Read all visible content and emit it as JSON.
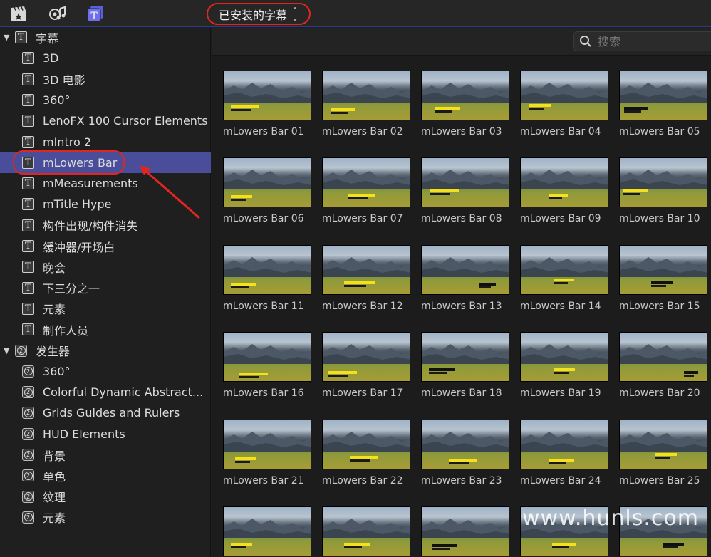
{
  "toolbar": {
    "dropdown_label": "已安装的字幕",
    "dropdown_chevron": "⌃⌄",
    "icons": [
      "clapper-star-icon",
      "music-camera-icon",
      "titles-icon"
    ]
  },
  "sidebar": {
    "groups": [
      {
        "label": "字幕",
        "icon": "titles-icon",
        "items": [
          {
            "label": "3D"
          },
          {
            "label": "3D 电影"
          },
          {
            "label": "360°"
          },
          {
            "label": "LenoFX 100 Cursor Elements"
          },
          {
            "label": "mIntro 2"
          },
          {
            "label": "mLowers Bar",
            "selected": true
          },
          {
            "label": "mMeasurements"
          },
          {
            "label": "mTitle Hype"
          },
          {
            "label": "构件出现/构件消失"
          },
          {
            "label": "缓冲器/开场白"
          },
          {
            "label": "晚会"
          },
          {
            "label": "下三分之一"
          },
          {
            "label": "元素"
          },
          {
            "label": "制作人员"
          }
        ]
      },
      {
        "label": "发生器",
        "icon": "generator-icon",
        "items": [
          {
            "label": "360°"
          },
          {
            "label": "Colorful Dynamic Abstract..."
          },
          {
            "label": "Grids Guides and Rulers"
          },
          {
            "label": "HUD Elements"
          },
          {
            "label": "背景"
          },
          {
            "label": "单色"
          },
          {
            "label": "纹理"
          },
          {
            "label": "元素"
          }
        ]
      }
    ]
  },
  "search": {
    "placeholder": "搜索"
  },
  "grid": {
    "tiles": [
      {
        "caption": "mLowers Bar 01"
      },
      {
        "caption": "mLowers Bar 02"
      },
      {
        "caption": "mLowers Bar 03"
      },
      {
        "caption": "mLowers Bar 04"
      },
      {
        "caption": "mLowers Bar 05"
      },
      {
        "caption": "mLowers Bar 06"
      },
      {
        "caption": "mLowers Bar 07"
      },
      {
        "caption": "mLowers Bar 08"
      },
      {
        "caption": "mLowers Bar 09"
      },
      {
        "caption": "mLowers Bar 10"
      },
      {
        "caption": "mLowers Bar 11"
      },
      {
        "caption": "mLowers Bar 12"
      },
      {
        "caption": "mLowers Bar 13"
      },
      {
        "caption": "mLowers Bar 14"
      },
      {
        "caption": "mLowers Bar 15"
      },
      {
        "caption": "mLowers Bar 16"
      },
      {
        "caption": "mLowers Bar 17"
      },
      {
        "caption": "mLowers Bar 18"
      },
      {
        "caption": "mLowers Bar 19"
      },
      {
        "caption": "mLowers Bar 20"
      },
      {
        "caption": "mLowers Bar 21"
      },
      {
        "caption": "mLowers Bar 22"
      },
      {
        "caption": "mLowers Bar 23"
      },
      {
        "caption": "mLowers Bar 24"
      },
      {
        "caption": "mLowers Bar 25"
      },
      {
        "caption": ""
      },
      {
        "caption": ""
      },
      {
        "caption": ""
      },
      {
        "caption": ""
      },
      {
        "caption": ""
      }
    ]
  },
  "watermark": "www.hunls.com",
  "colors": {
    "selection": "#4a4d9a",
    "annotation_red": "#e0261f",
    "accent_blue": "#2c3a8c"
  }
}
